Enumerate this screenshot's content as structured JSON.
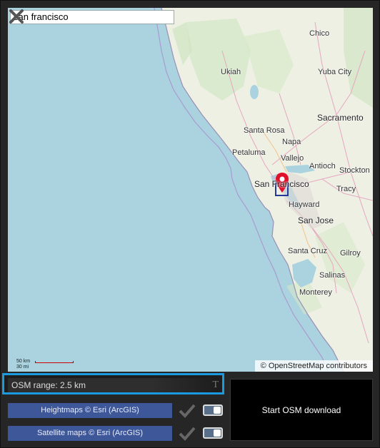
{
  "search": {
    "value": "san francisco"
  },
  "map": {
    "attribution": "© OpenStreetMap contributors",
    "scale_km": "50 km",
    "scale_mi": "30 mi",
    "cities": [
      "Chico",
      "Ukiah",
      "Yuba City",
      "Sacramento",
      "Santa Rosa",
      "Napa",
      "Petaluma",
      "Vallejo",
      "Antioch",
      "Stockton",
      "San Francisco",
      "Tracy",
      "Hayward",
      "San Jose",
      "Santa Cruz",
      "Gilroy",
      "Salinas",
      "Monterey"
    ]
  },
  "controls": {
    "osm_range": "OSM range: 2.5 km",
    "heightmaps_label": "Heightmaps © Esri (ArcGIS)",
    "satellite_label": "Satellite maps © Esri (ArcGIS)",
    "start_label": "Start OSM download"
  },
  "colors": {
    "accent": "#1a9be0",
    "button_blue": "#3e5798",
    "water": "#aad3df",
    "land": "#eef0e4",
    "marker": "#e0102b"
  },
  "icons": {
    "close": "close-icon",
    "marker": "map-pin-icon",
    "check": "checkmark-icon"
  }
}
